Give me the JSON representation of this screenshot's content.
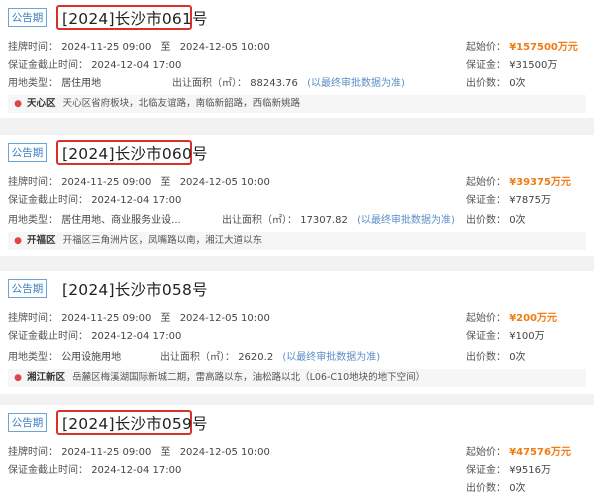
{
  "labels": {
    "listing_time": "挂牌时间：",
    "to": "至",
    "deposit_deadline": "保证金截止时间：",
    "land_use": "用地类型：",
    "area_label": "出让面积（㎡）：",
    "area_note": "(以最终审批数据为准)",
    "start_price": "起始价：",
    "deposit": "保证金：",
    "bids": "出价数："
  },
  "listings": [
    {
      "badge": "公告期",
      "title": "[2024]长沙市061号",
      "highlighted": true,
      "start_time": "2024-11-25 09:00",
      "end_time": "2024-12-05 10:00",
      "deposit_deadline": "2024-12-04 17:00",
      "land_use": "居住用地",
      "area": "88243.76",
      "district": "天心区",
      "location": "天心区省府板块，北临友谊路，南临新韶路，西临新姚路",
      "start_price": "¥157500万元",
      "deposit": "¥31500万",
      "bids": "0次"
    },
    {
      "badge": "公告期",
      "title": "[2024]长沙市060号",
      "highlighted": true,
      "start_time": "2024-11-25 09:00",
      "end_time": "2024-12-05 10:00",
      "deposit_deadline": "2024-12-04 17:00",
      "land_use": "居住用地、商业服务业设...",
      "area": "17307.82",
      "district": "开福区",
      "location": "开福区三角洲片区，凤嘴路以南，湘江大道以东",
      "start_price": "¥39375万元",
      "deposit": "¥7875万",
      "bids": "0次"
    },
    {
      "badge": "公告期",
      "title": "[2024]长沙市058号",
      "highlighted": false,
      "start_time": "2024-11-25 09:00",
      "end_time": "2024-12-05 10:00",
      "deposit_deadline": "2024-12-04 17:00",
      "land_use": "公用设施用地",
      "area": "2620.2",
      "district": "湘江新区",
      "location": "岳麓区梅溪湖国际新城二期，雷高路以东，油松路以北（L06-C10地块的地下空间）",
      "start_price": "¥200万元",
      "deposit": "¥100万",
      "bids": "0次"
    },
    {
      "badge": "公告期",
      "title": "[2024]长沙市059号",
      "highlighted": true,
      "start_time": "2024-11-25 09:00",
      "end_time": "2024-12-05 10:00",
      "deposit_deadline": "2024-12-04 17:00",
      "start_price": "¥47576万元",
      "deposit": "¥9516万",
      "bids": "0次"
    }
  ]
}
